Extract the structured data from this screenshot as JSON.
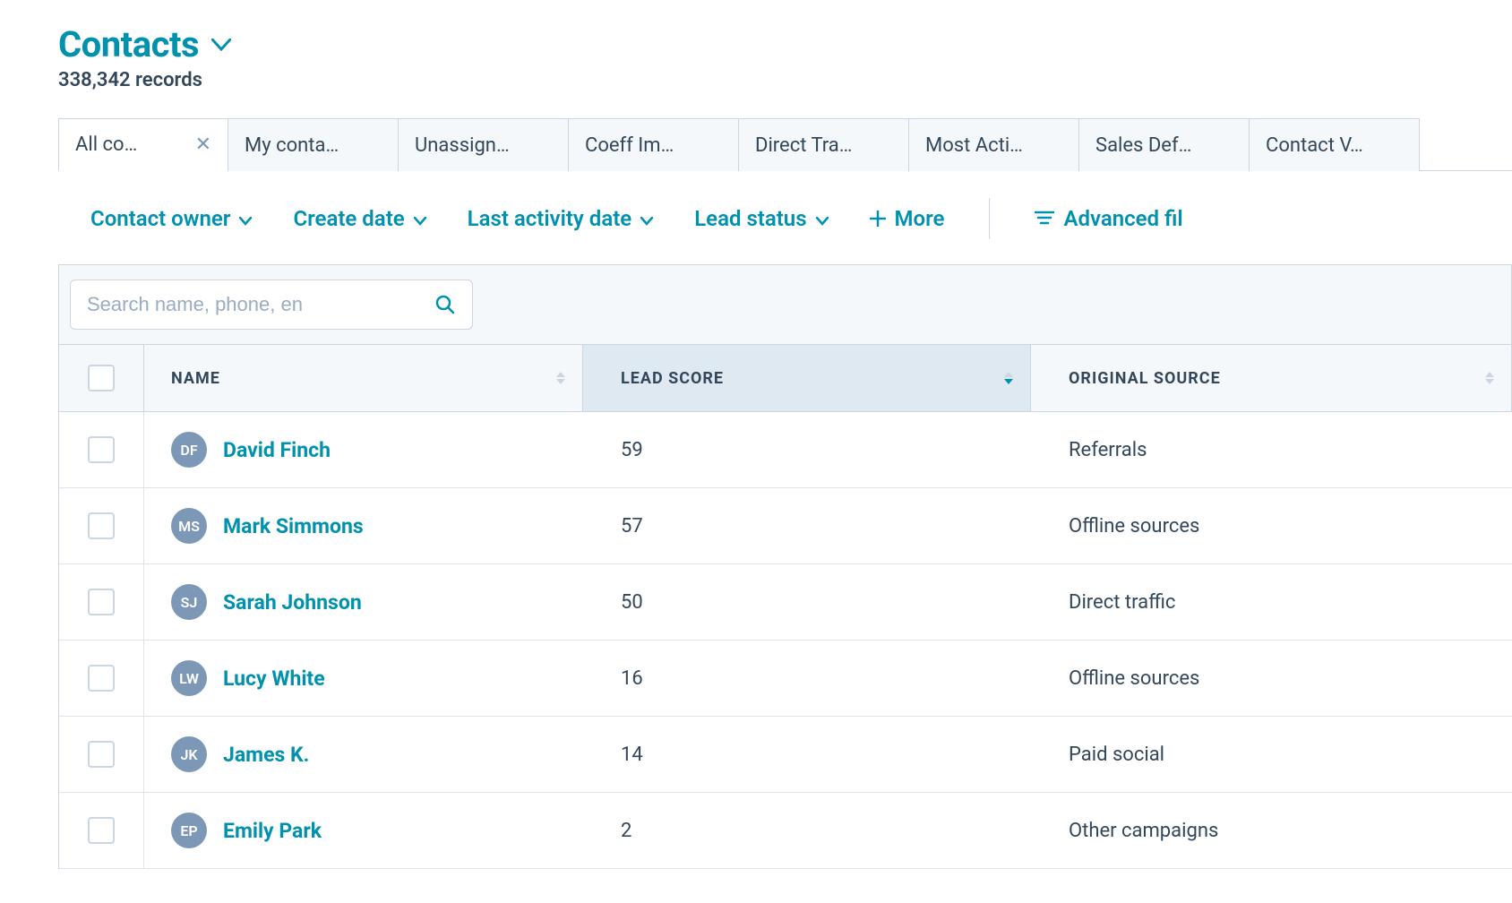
{
  "header": {
    "title": "Contacts",
    "records_label": "338,342 records"
  },
  "tabs": [
    {
      "label": "All co…",
      "closable": true,
      "active": true
    },
    {
      "label": "My conta…",
      "closable": false
    },
    {
      "label": "Unassign…",
      "closable": false
    },
    {
      "label": "Coeff Im…",
      "closable": false
    },
    {
      "label": "Direct Tra…",
      "closable": false
    },
    {
      "label": "Most Acti…",
      "closable": false
    },
    {
      "label": "Sales Def…",
      "closable": false
    },
    {
      "label": "Contact V…",
      "closable": false
    }
  ],
  "filters": {
    "contact_owner": "Contact owner",
    "create_date": "Create date",
    "last_activity_date": "Last activity date",
    "lead_status": "Lead status",
    "more": "More",
    "advanced": "Advanced fil"
  },
  "search": {
    "placeholder": "Search name, phone, en"
  },
  "table": {
    "columns": {
      "name": "NAME",
      "lead_score": "LEAD SCORE",
      "original_source": "ORIGINAL SOURCE"
    },
    "sorted_by": "lead_score_desc",
    "rows": [
      {
        "initials": "DF",
        "name": "David Finch",
        "lead_score": "59",
        "source": "Referrals"
      },
      {
        "initials": "MS",
        "name": "Mark Simmons",
        "lead_score": "57",
        "source": "Offline sources"
      },
      {
        "initials": "SJ",
        "name": "Sarah Johnson",
        "lead_score": "50",
        "source": "Direct traffic"
      },
      {
        "initials": "LW",
        "name": "Lucy White",
        "lead_score": "16",
        "source": "Offline sources"
      },
      {
        "initials": "JK",
        "name": "James K.",
        "lead_score": "14",
        "source": "Paid social"
      },
      {
        "initials": "EP",
        "name": "Emily Park",
        "lead_score": "2",
        "source": "Other campaigns"
      }
    ]
  }
}
